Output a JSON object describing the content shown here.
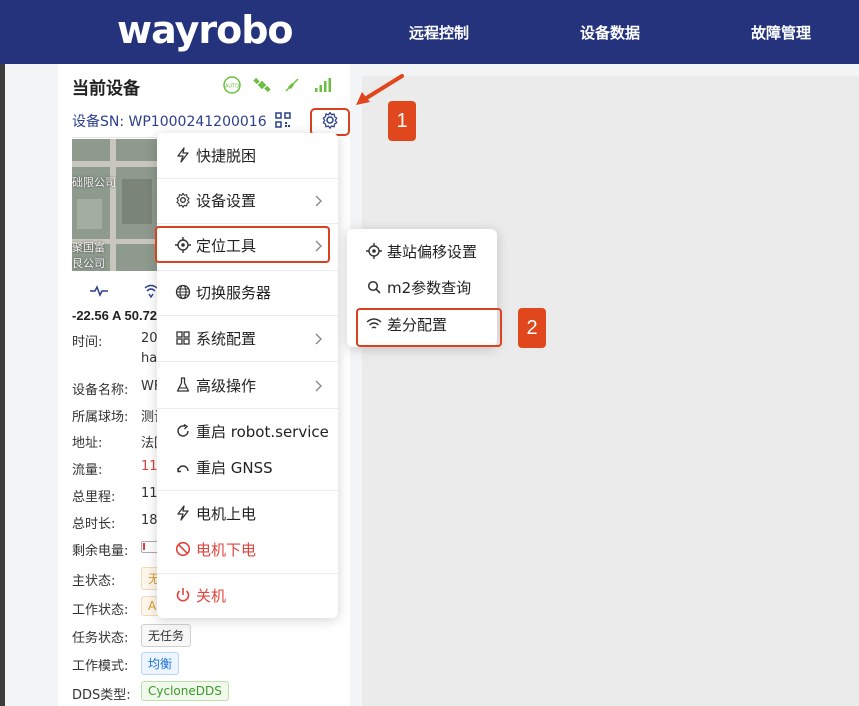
{
  "header": {
    "logo": "wayrobo",
    "nav": [
      "远程控制",
      "设备数据",
      "故障管理"
    ]
  },
  "sidebar": {
    "title": "当前设备",
    "sn": "设备SN: WP1000241200016",
    "map_labels": [
      "础限公司",
      "聚国富",
      "艮公司"
    ],
    "reading": "-22.56 A 50.72",
    "info": [
      {
        "label": "时间:",
        "value": "202"
      },
      {
        "label": "",
        "value": "hai"
      },
      {
        "label": "设备名称:",
        "value": "WF"
      },
      {
        "label": "所属球场:",
        "value": "测试"
      },
      {
        "label": "地址:",
        "value": "法国"
      },
      {
        "label": "流量:",
        "value": "11."
      },
      {
        "label": "总里程:",
        "value": "117"
      },
      {
        "label": "总时长:",
        "value": "180"
      },
      {
        "label": "剩余电量:",
        "value": ""
      },
      {
        "label": "主状态:",
        "value": "无"
      },
      {
        "label": "工作状态:",
        "value": "A"
      },
      {
        "label": "任务状态:",
        "value": "无任务"
      },
      {
        "label": "工作模式:",
        "value": "均衡"
      },
      {
        "label": "DDS类型:",
        "value": "CycloneDDS"
      }
    ]
  },
  "menu": {
    "items": [
      {
        "label": "快捷脱困",
        "icon": "bolt-icon"
      },
      {
        "label": "设备设置",
        "icon": "gear-icon",
        "submenu": true
      },
      {
        "label": "定位工具",
        "icon": "locate-icon",
        "submenu": true
      },
      {
        "label": "切换服务器",
        "icon": "globe-icon"
      },
      {
        "label": "系统配置",
        "icon": "grid-icon",
        "submenu": true
      },
      {
        "label": "高级操作",
        "icon": "flask-icon",
        "submenu": true
      },
      {
        "label": "重启 robot.service",
        "icon": "refresh-icon"
      },
      {
        "label": "重启 GNSS",
        "icon": "refresh-icon"
      },
      {
        "label": "电机上电",
        "icon": "bolt-icon"
      },
      {
        "label": "电机下电",
        "icon": "ban-icon",
        "danger": true
      },
      {
        "label": "关机",
        "icon": "power-icon",
        "danger": true
      }
    ]
  },
  "submenu": {
    "items": [
      {
        "label": "基站偏移设置",
        "icon": "locate-icon"
      },
      {
        "label": "m2参数查询",
        "icon": "search-icon"
      },
      {
        "label": "差分配置",
        "icon": "wifi-icon"
      }
    ]
  },
  "annotations": {
    "step1": "1",
    "step2": "2"
  },
  "colors": {
    "header": "#24337c",
    "accent": "#d9421f",
    "danger": "#e0443d"
  }
}
